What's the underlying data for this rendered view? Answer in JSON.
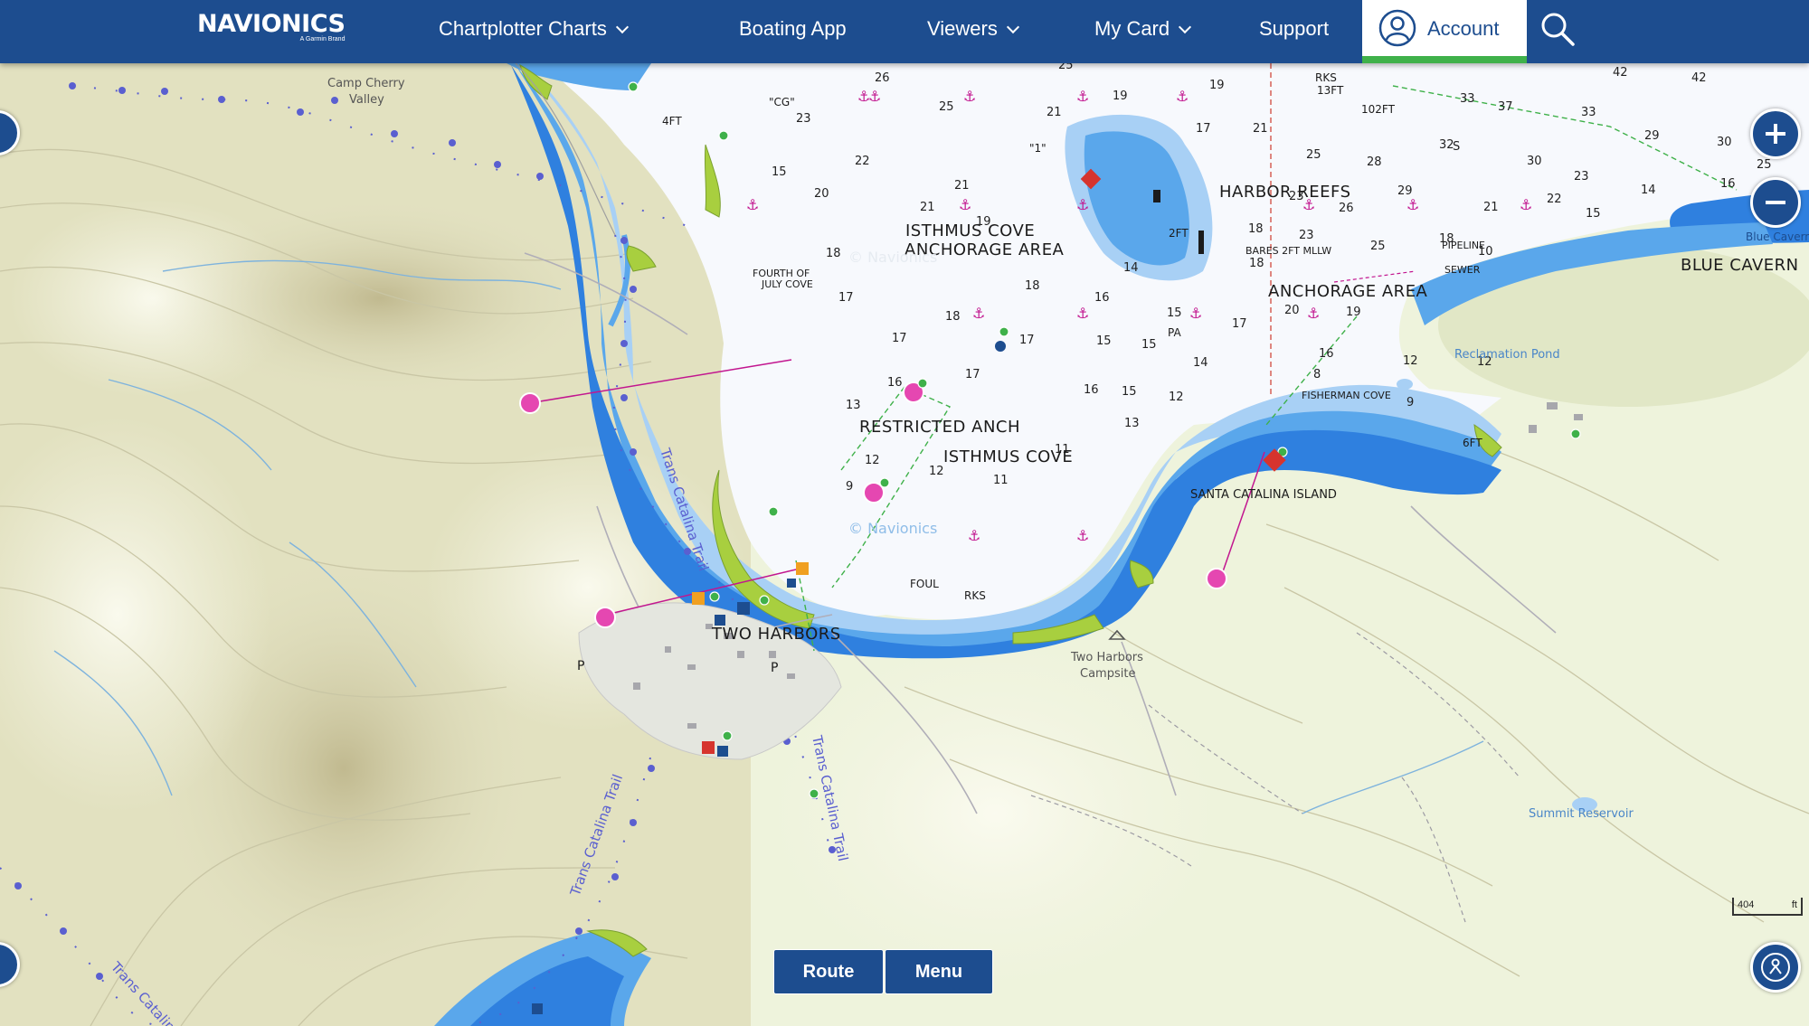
{
  "nav": {
    "brand": "NAVIONICS",
    "brand_sub": "A Garmin Brand",
    "items": [
      "Chartplotter Charts",
      "Boating App",
      "Viewers",
      "My Card",
      "Support"
    ],
    "account": "Account"
  },
  "controls": {
    "route": "Route",
    "menu": "Menu",
    "scale_value": "404",
    "scale_unit": "ft"
  },
  "map": {
    "colors": {
      "land": "#eef3dc",
      "hills": "#c8c39a",
      "water_white": "#f6f9fd",
      "shallow_light": "#a8d0f5",
      "shallow_mid": "#5aa7eb",
      "shallow_deep": "#2f80df",
      "intertidal": "#a8cf3f",
      "magenta": "#c2168f",
      "trail": "#5a5fd0"
    },
    "place_names": {
      "isthmus_cove_anchorage": "ISTHMUS COVE",
      "anchorage_area": "ANCHORAGE AREA",
      "harbor_reefs": "HARBOR REEFS",
      "anchorage_area_2": "ANCHORAGE AREA",
      "blue_cavern": "BLUE CAVERN",
      "blue_cavern_small": "Blue Cavern",
      "restricted_anch": "RESTRICTED ANCH",
      "isthmus_cove": "ISTHMUS COVE",
      "santa_catalina": "SANTA CATALINA ISLAND",
      "two_harbors": "TWO HARBORS",
      "two_harbors_campsite_1": "Two Harbors",
      "two_harbors_campsite_2": "Campsite",
      "camp_cherry_1": "Camp Cherry",
      "camp_cherry_2": "Valley",
      "reclamation_pond": "Reclamation Pond",
      "summit_reservoir": "Summit Reservoir",
      "fisherman_cove": "FISHERMAN COVE",
      "fourth_cove_1": "FOURTH OF",
      "fourth_cove_2": "JULY COVE",
      "trans_catalina_1": "Trans Catalina Trail",
      "trans_catalina_2": "Trans Catalina Trail",
      "trans_catalina_3": "Trans Catalina Trail",
      "trans_catalina_4": "Trans Catalina",
      "bares": "BARES 2FT MLLW",
      "pipeline": "PIPELINE",
      "sewer": "SEWER",
      "foul": "FOUL",
      "rks": "RKS",
      "rks13ft": "RKS",
      "ft13": "13FT",
      "ft102": "102FT",
      "ft2": "2FT",
      "ft4": "4FT",
      "ft6": "6FT",
      "cg": "\"CG\"",
      "one": "\"1\"",
      "pa": "PA",
      "p1": "P",
      "p2": "P",
      "navionics_wm1": "© Navionics",
      "navionics_wm2": "© Navionics"
    },
    "soundings": [
      [
        "26",
        967,
        90
      ],
      [
        "25",
        1038,
        122
      ],
      [
        "25",
        1170,
        76
      ],
      [
        "21",
        1157,
        128
      ],
      [
        "19",
        1230,
        110
      ],
      [
        "19",
        1337,
        98
      ],
      [
        "17",
        1322,
        146
      ],
      [
        "21",
        1385,
        146
      ],
      [
        "23",
        880,
        135
      ],
      [
        "15",
        853,
        194
      ],
      [
        "22",
        945,
        182
      ],
      [
        "20",
        900,
        218
      ],
      [
        "21",
        1055,
        209
      ],
      [
        "21",
        1017,
        233
      ],
      [
        "19",
        1079,
        249
      ],
      [
        "18",
        913,
        284
      ],
      [
        "17",
        927,
        333
      ],
      [
        "17",
        986,
        378
      ],
      [
        "18",
        1045,
        354
      ],
      [
        "18",
        1133,
        320
      ],
      [
        "16",
        1210,
        333
      ],
      [
        "15",
        1212,
        381
      ],
      [
        "17",
        1127,
        380
      ],
      [
        "15",
        1262,
        385
      ],
      [
        "16",
        981,
        427
      ],
      [
        "17",
        1067,
        418
      ],
      [
        "13",
        935,
        452
      ],
      [
        "14",
        1319,
        405
      ],
      [
        "15",
        1290,
        350
      ],
      [
        "16",
        1198,
        435
      ],
      [
        "15",
        1240,
        437
      ],
      [
        "12",
        1292,
        443
      ],
      [
        "13",
        1243,
        472
      ],
      [
        "12",
        956,
        513
      ],
      [
        "12",
        1027,
        525
      ],
      [
        "11",
        1098,
        535
      ],
      [
        "9",
        935,
        542
      ],
      [
        "11",
        1166,
        501
      ],
      [
        "14",
        1242,
        300
      ],
      [
        "18",
        1381,
        295
      ],
      [
        "17",
        1362,
        362
      ],
      [
        "20",
        1420,
        347
      ],
      [
        "19",
        1488,
        349
      ],
      [
        "18",
        1380,
        257
      ],
      [
        "23",
        1436,
        264
      ],
      [
        "23",
        1425,
        221
      ],
      [
        "25",
        1444,
        175
      ],
      [
        "26",
        1480,
        234
      ],
      [
        "28",
        1511,
        183
      ],
      [
        "25",
        1515,
        276
      ],
      [
        "32",
        1591,
        164
      ],
      [
        "S",
        1606,
        166
      ],
      [
        "29",
        1545,
        215
      ],
      [
        "21",
        1640,
        233
      ],
      [
        "22",
        1710,
        224
      ],
      [
        "23",
        1740,
        199
      ],
      [
        "30",
        1688,
        182
      ],
      [
        "33",
        1748,
        128
      ],
      [
        "37",
        1656,
        122
      ],
      [
        "33",
        1614,
        113
      ],
      [
        "42",
        1783,
        84
      ],
      [
        "42",
        1870,
        90
      ],
      [
        "29",
        1818,
        154
      ],
      [
        "30",
        1898,
        161
      ],
      [
        "25",
        1942,
        186
      ],
      [
        "15",
        1753,
        240
      ],
      [
        "16",
        1902,
        207
      ],
      [
        "14",
        1814,
        214
      ],
      [
        "10",
        1634,
        282
      ],
      [
        "8",
        1452,
        418
      ],
      [
        "12",
        1551,
        403
      ],
      [
        "12",
        1633,
        404
      ],
      [
        "9",
        1555,
        449
      ],
      [
        "18",
        1591,
        268
      ],
      [
        "16",
        1458,
        395
      ]
    ]
  }
}
